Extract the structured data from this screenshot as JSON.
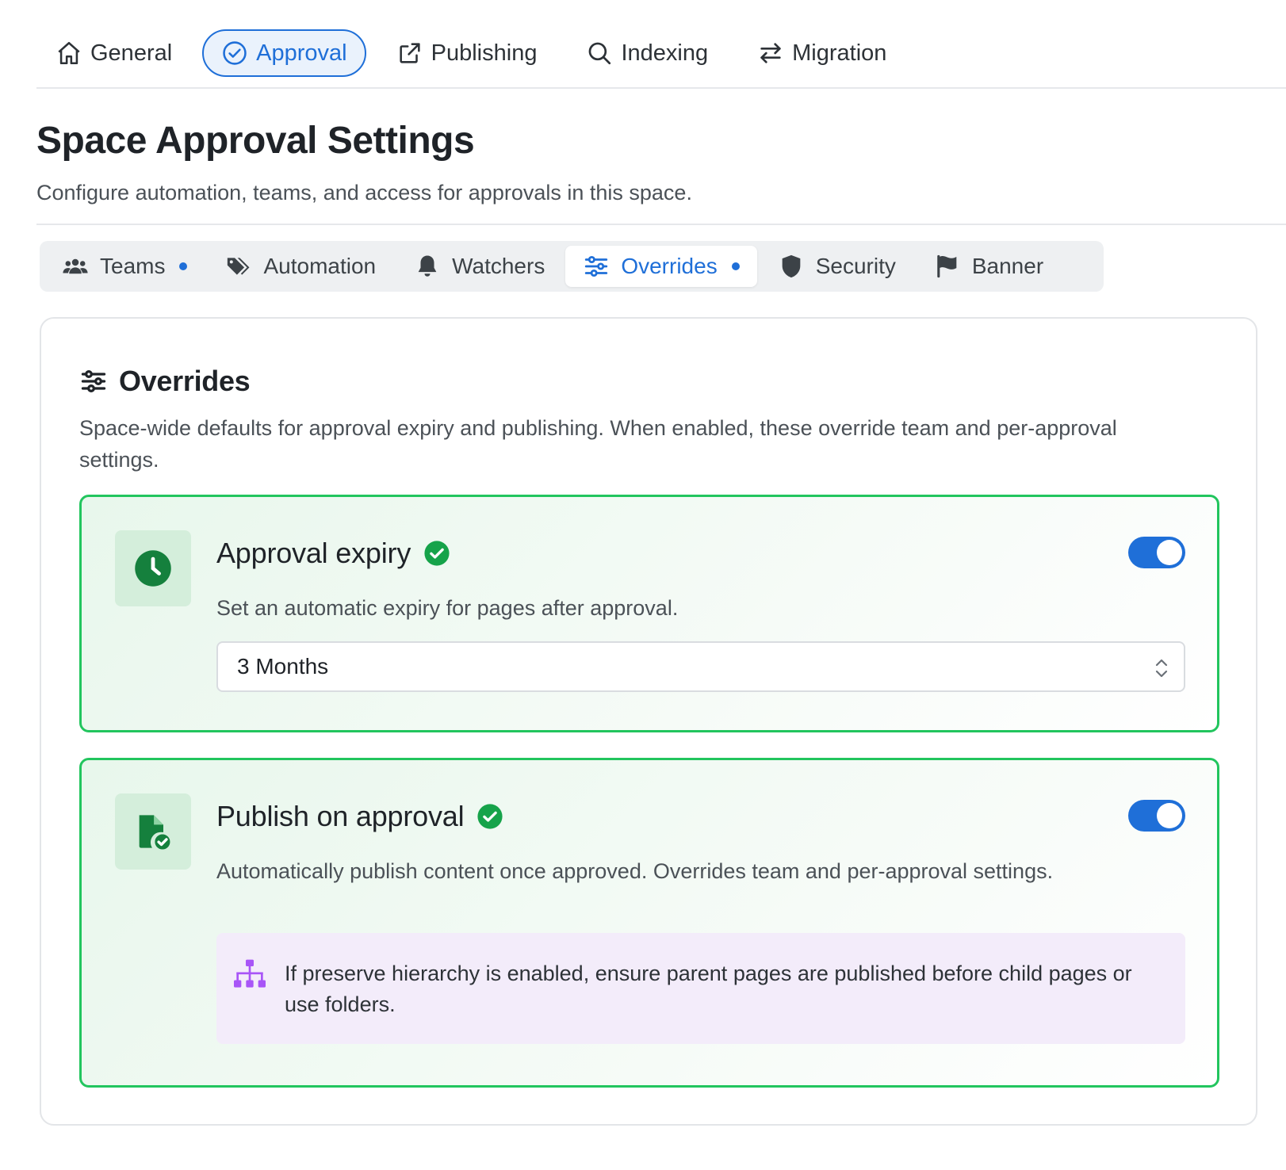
{
  "topnav": {
    "items": [
      {
        "label": "General",
        "icon": "home-icon"
      },
      {
        "label": "Approval",
        "icon": "check-circle-icon",
        "active": true
      },
      {
        "label": "Publishing",
        "icon": "share-icon"
      },
      {
        "label": "Indexing",
        "icon": "search-icon"
      },
      {
        "label": "Migration",
        "icon": "swap-arrows-icon"
      }
    ]
  },
  "header": {
    "title": "Space Approval Settings",
    "subtitle": "Configure automation, teams, and access for approvals in this space."
  },
  "subtabs": {
    "items": [
      {
        "label": "Teams",
        "icon": "users-icon",
        "dot": true
      },
      {
        "label": "Automation",
        "icon": "tags-icon"
      },
      {
        "label": "Watchers",
        "icon": "bell-icon"
      },
      {
        "label": "Overrides",
        "icon": "sliders-icon",
        "dot": true,
        "active": true
      },
      {
        "label": "Security",
        "icon": "shield-icon"
      },
      {
        "label": "Banner",
        "icon": "flag-icon"
      }
    ]
  },
  "overrides": {
    "title": "Overrides",
    "description": "Space-wide defaults for approval expiry and publishing. When enabled, these override team and per-approval settings.",
    "approval_expiry": {
      "title": "Approval expiry",
      "description": "Set an automatic expiry for pages after approval.",
      "enabled": true,
      "select_value": "3 Months"
    },
    "publish_on_approval": {
      "title": "Publish on approval",
      "description": "Automatically publish content once approved. Overrides team and per-approval settings.",
      "enabled": true,
      "notice": "If preserve hierarchy is enabled, ensure parent pages are published before child pages or use folders."
    }
  },
  "colors": {
    "accent": "#1f6fd8",
    "success_border": "#22c55e",
    "success_icon": "#15803d",
    "notice_bg": "#f3ecfa",
    "notice_icon": "#a855f7"
  }
}
